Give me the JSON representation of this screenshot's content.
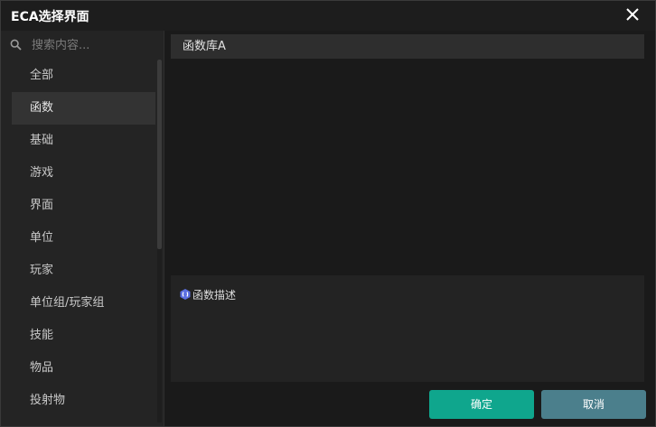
{
  "window": {
    "title": "ECA选择界面"
  },
  "colors": {
    "accent": "#0fa68d",
    "cancel": "#4b7f8c",
    "active_item": "#333333"
  },
  "search": {
    "placeholder": "搜索内容...",
    "value": ""
  },
  "sidebar": {
    "items": [
      {
        "label": "全部"
      },
      {
        "label": "函数",
        "active": true
      },
      {
        "label": "基础"
      },
      {
        "label": "游戏"
      },
      {
        "label": "界面"
      },
      {
        "label": "单位"
      },
      {
        "label": "玩家"
      },
      {
        "label": "单位组/玩家组"
      },
      {
        "label": "技能"
      },
      {
        "label": "物品"
      },
      {
        "label": "投射物"
      }
    ]
  },
  "main": {
    "library_item": "函数库A",
    "description": {
      "icon": "function-badge-icon",
      "label": "函数描述"
    }
  },
  "footer": {
    "confirm_label": "确定",
    "cancel_label": "取消"
  }
}
